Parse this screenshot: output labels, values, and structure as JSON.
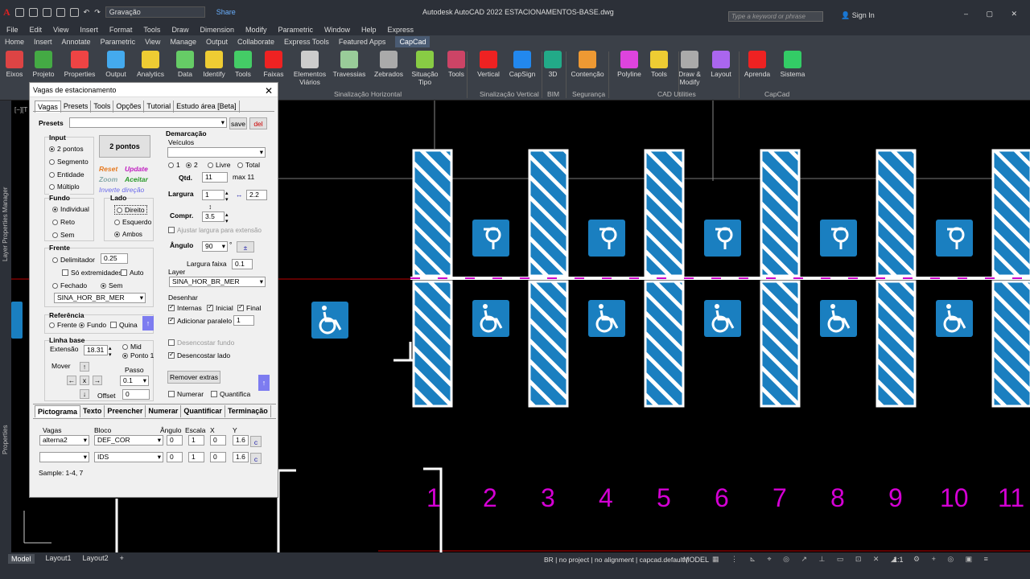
{
  "titlebar": {
    "workspace": "Gravação",
    "share": "Share",
    "app_title": "Autodesk AutoCAD 2022   ESTACIONAMENTOS-BASE.dwg",
    "search_placeholder": "Type a keyword or phrase",
    "sign_in": "Sign In"
  },
  "menu": [
    "File",
    "Edit",
    "View",
    "Insert",
    "Format",
    "Tools",
    "Draw",
    "Dimension",
    "Modify",
    "Parametric",
    "Window",
    "Help",
    "Express"
  ],
  "ribbon_tabs": [
    "Home",
    "Insert",
    "Annotate",
    "Parametric",
    "View",
    "Manage",
    "Output",
    "Collaborate",
    "Express Tools",
    "Featured Apps",
    "CapCad"
  ],
  "ribbon_buttons": [
    {
      "label": "Eixos",
      "icon": "axes-icon",
      "color": "#d44"
    },
    {
      "label": "Projeto",
      "icon": "project-icon",
      "color": "#4a4"
    },
    {
      "label": "Properties",
      "icon": "gauge-icon",
      "color": "#e44"
    },
    {
      "label": "Output",
      "icon": "output-icon",
      "color": "#4ae"
    },
    {
      "label": "Analytics",
      "icon": "analytics-icon",
      "color": "#ec3"
    },
    {
      "label": "Data",
      "icon": "data-icon",
      "color": "#6c6"
    },
    {
      "label": "Identify",
      "icon": "identify-icon",
      "color": "#ec3"
    },
    {
      "label": "Tools",
      "icon": "tools-icon",
      "color": "#4c6"
    },
    {
      "label": "Faixas",
      "icon": "faixas-icon",
      "color": "#e22"
    },
    {
      "label": "Elementos\nViários",
      "icon": "elements-icon",
      "color": "#ccc"
    },
    {
      "label": "Travessias",
      "icon": "crossing-icon",
      "color": "#9c9"
    },
    {
      "label": "Zebrados",
      "icon": "zebra-icon",
      "color": "#aaa"
    },
    {
      "label": "Situação\nTipo",
      "icon": "situation-icon",
      "color": "#8c4"
    },
    {
      "label": "Tools",
      "icon": "tools2-icon",
      "color": "#c46"
    },
    {
      "label": "Vertical",
      "icon": "speed-sign-icon",
      "color": "#e22"
    },
    {
      "label": "CapSign",
      "icon": "capsign-icon",
      "color": "#28e"
    },
    {
      "label": "3D",
      "icon": "3d-icon",
      "color": "#2a8"
    },
    {
      "label": "Contenção",
      "icon": "barrier-icon",
      "color": "#e93"
    },
    {
      "label": "Polyline",
      "icon": "polyline-icon",
      "color": "#d4d"
    },
    {
      "label": "Tools",
      "icon": "tools3-icon",
      "color": "#ec3"
    },
    {
      "label": "Draw &\nModify",
      "icon": "draw-icon",
      "color": "#aaa"
    },
    {
      "label": "Layout",
      "icon": "layout-icon",
      "color": "#a6e"
    },
    {
      "label": "Aprenda",
      "icon": "youtube-icon",
      "color": "#e22"
    },
    {
      "label": "Sistema",
      "icon": "system-icon",
      "color": "#3c6"
    }
  ],
  "ribbon_groups": [
    "Sinalização Horizontal",
    "Sinalização Vertical",
    "BIM",
    "Segurança",
    "CAD Utilities",
    "CapCad"
  ],
  "left_panel": "Layer Properties Manager",
  "left_panel2": "Properties",
  "dialog": {
    "title": "Vagas de estacionamento",
    "tabs": [
      "Vagas",
      "Presets",
      "Tools",
      "Opções",
      "Tutorial",
      "Estudo área [Beta]"
    ],
    "presets_label": "Presets",
    "save": "save",
    "del": "del",
    "input_label": "Input",
    "input_opts": [
      "2 pontos",
      "Segmento",
      "Entidade",
      "Múltiplo"
    ],
    "mode_button": "2 pontos",
    "reset": "Reset",
    "update": "Update",
    "zoom": "Zoom",
    "aceitar": "Aceitar",
    "inverte": "Inverte direção",
    "fundo_label": "Fundo",
    "fundo_opts": [
      "Individual",
      "Reto",
      "Sem"
    ],
    "lado_label": "Lado",
    "lado_opts": [
      "Direito",
      "Esquerdo",
      "Ambos"
    ],
    "frente_label": "Frente",
    "delimitador": "Delimitador",
    "delimitador_val": "0.25",
    "so_extremidades": "Só extremidades",
    "auto": "Auto",
    "fechado": "Fechado",
    "sem": "Sem",
    "frente_layer": "SINA_HOR_BR_MER",
    "referencia_label": "Referência",
    "ref_opts": [
      "Frente",
      "Fundo"
    ],
    "quina": "Quina",
    "linha_base": "Linha base",
    "extensao": "Extensão",
    "extensao_val": "18.31",
    "mid": "Mid",
    "ponto1": "Ponto 1",
    "mover": "Mover",
    "passo": "Passo",
    "passo_val": "0.1",
    "offset": "Offset",
    "offset_val": "0",
    "x": "x",
    "demarcacao": "Demarcação",
    "veiculos": "Veículos",
    "veic_opts": [
      "1",
      "2",
      "Livre",
      "Total"
    ],
    "qtd": "Qtd.",
    "qtd_val": "11",
    "max": "max 11",
    "largura": "Largura",
    "largura_val": "1",
    "largura_val2": "2.2",
    "compr": "Compr.",
    "compr_val": "3.5",
    "ajustar": "Ajustar largura para extensão",
    "angulo": "Ângulo",
    "angulo_val": "90",
    "degree": "°",
    "largura_faixa": "Largura faixa",
    "largura_faixa_val": "0.1",
    "layer_label": "Layer",
    "layer_val": "SINA_HOR_BR_MER",
    "desenhar": "Desenhar",
    "internas": "Internas",
    "inicial": "Inicial",
    "final": "Final",
    "adicionar_paralelo": "Adicionar paralelo",
    "paralelo_val": "1",
    "desencostar_fundo": "Desencostar fundo",
    "desencostar_lado": "Desencostar lado",
    "remover_extras": "Remover extras",
    "numerar": "Numerar",
    "quantifica": "Quantifica",
    "bottom_tabs": [
      "Pictograma",
      "Texto",
      "Preencher",
      "Numerar",
      "Quantificar",
      "Terminação"
    ],
    "grid_headers": [
      "Vagas",
      "Bloco",
      "Ângulo",
      "Escala",
      "X",
      "Y"
    ],
    "grid_rows": [
      {
        "vagas": "alterna2",
        "bloco": "DEF_COR",
        "angulo": "0",
        "escala": "1",
        "x": "0",
        "y": "1.6",
        "c": "c"
      },
      {
        "vagas": "",
        "bloco": "IDS",
        "angulo": "0",
        "escala": "1",
        "x": "0",
        "y": "1.6",
        "c": "c"
      }
    ],
    "sample": "Sample: 1-4, 7"
  },
  "viewport_label": "[−][T",
  "drawing": {
    "numbers": [
      "1",
      "2",
      "3",
      "4",
      "5",
      "6",
      "7",
      "8",
      "9",
      "10",
      "11"
    ],
    "stripe_color": "#1a7fc0",
    "symbol_color": "#1a7fc0",
    "number_color": "#d400d4"
  },
  "status": {
    "tabs": [
      "Model",
      "Layout1",
      "Layout2"
    ],
    "info": "BR | no project | no alignment | capcad.default |",
    "model": "MODEL",
    "scale": "1:1"
  }
}
